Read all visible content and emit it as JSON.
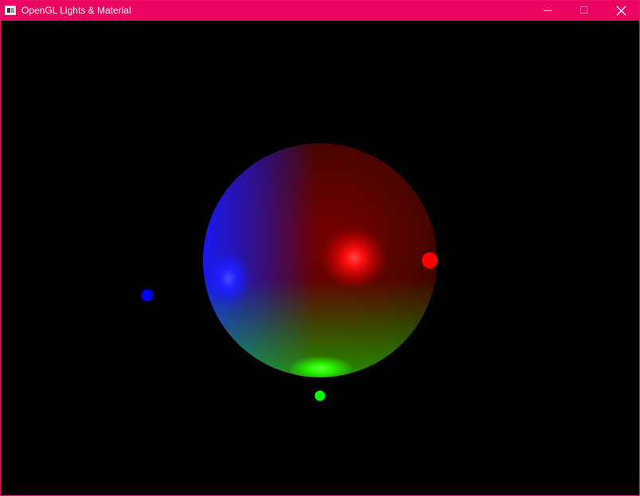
{
  "window": {
    "title": "OpenGL Lights & Material",
    "colors": {
      "titlebar": "#ec0560",
      "border": "#ec0d6a",
      "viewport_background": "#000000"
    },
    "icons": {
      "app": "application-window-icon",
      "minimize": "minimize-icon",
      "maximize": "maximize-icon",
      "close": "close-icon"
    }
  },
  "scene": {
    "sphere": {
      "base_color": "#6a0a00",
      "lit_by": [
        "red",
        "blue",
        "green"
      ]
    },
    "lights": [
      {
        "name": "red",
        "color": "#ff0000"
      },
      {
        "name": "blue",
        "color": "#0000ff"
      },
      {
        "name": "green",
        "color": "#00ff00"
      }
    ]
  }
}
